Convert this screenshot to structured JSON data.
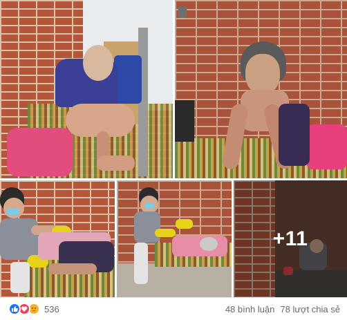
{
  "gallery": {
    "more_count_label": "+11"
  },
  "footer": {
    "reaction_icons": [
      "like-icon",
      "love-icon",
      "sad-icon"
    ],
    "reaction_count": "536",
    "comments_label": "48 bình luận",
    "shares_label": "78 lượt chia sẻ"
  },
  "colors": {
    "like": "#1877f2",
    "love": "#f33e58",
    "sad": "#f7b125",
    "text_muted": "#65676b"
  }
}
